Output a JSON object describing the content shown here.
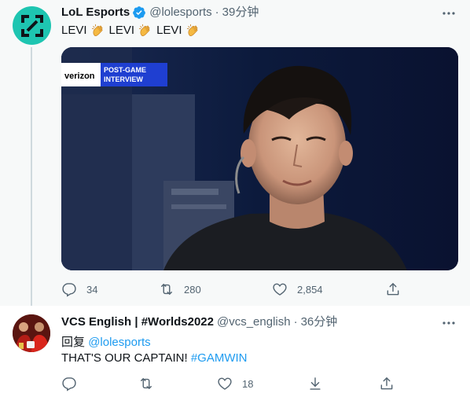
{
  "tweet1": {
    "author_name": "LoL Esports",
    "handle": "@lolesports",
    "time": "39分钟",
    "text_parts": [
      "LEVI",
      "LEVI",
      "LEVI"
    ],
    "media": {
      "sponsor": "verizon",
      "overlay_line1": "POST-GAME",
      "overlay_line2": "INTERVIEW"
    },
    "replies": "34",
    "retweets": "280",
    "likes": "2,854"
  },
  "tweet2": {
    "author_name": "VCS English | #Worlds2022",
    "handle": "@vcs_english",
    "time": "36分钟",
    "reply_prefix": "回复",
    "reply_mention": "@lolesports",
    "body_text": "THAT'S OUR CAPTAIN! ",
    "body_hashtag": "#GAMWIN",
    "replies": "",
    "retweets": "",
    "likes": "18"
  },
  "colors": {
    "accent": "#1d9bf0",
    "secondary_text": "#536471",
    "avatar_teal": "#1ec5b1"
  },
  "icons": [
    "verified-badge-icon",
    "more-icon",
    "reply-icon",
    "retweet-icon",
    "like-icon",
    "share-icon",
    "download-icon",
    "clap-emoji-icon"
  ]
}
